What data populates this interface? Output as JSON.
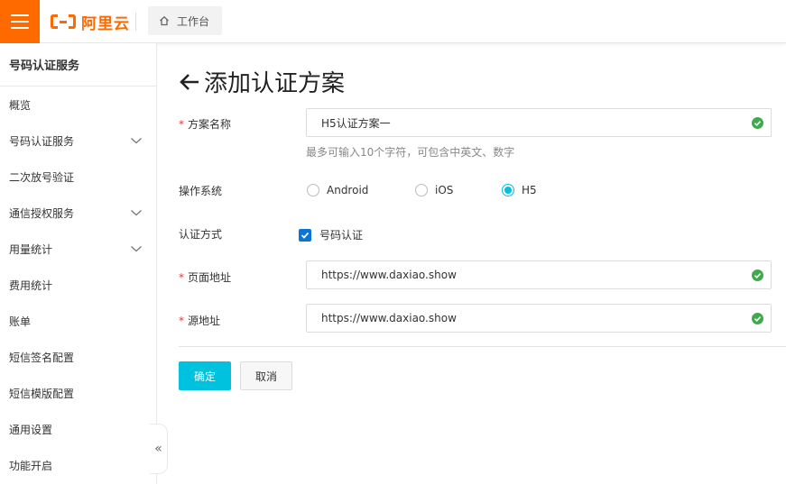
{
  "topbar": {
    "logo_text": "阿里云",
    "workbench_label": "工作台"
  },
  "sidebar": {
    "title": "号码认证服务",
    "items": [
      {
        "label": "概览",
        "expandable": false
      },
      {
        "label": "号码认证服务",
        "expandable": true
      },
      {
        "label": "二次放号验证",
        "expandable": false
      },
      {
        "label": "通信授权服务",
        "expandable": true
      },
      {
        "label": "用量统计",
        "expandable": true
      },
      {
        "label": "费用统计",
        "expandable": false
      },
      {
        "label": "账单",
        "expandable": false
      },
      {
        "label": "短信签名配置",
        "expandable": false
      },
      {
        "label": "短信模版配置",
        "expandable": false
      },
      {
        "label": "通用设置",
        "expandable": false
      },
      {
        "label": "功能开启",
        "expandable": false
      }
    ]
  },
  "page": {
    "title": "添加认证方案"
  },
  "form": {
    "required_mark": "*",
    "scheme_name": {
      "label": "方案名称",
      "value": "H5认证方案一",
      "hint": "最多可输入10个字符，可包含中英文、数字"
    },
    "os": {
      "label": "操作系统",
      "options": [
        "Android",
        "iOS",
        "H5"
      ],
      "selected": "H5"
    },
    "auth_method": {
      "label": "认证方式",
      "checkbox_label": "号码认证",
      "checked": true
    },
    "page_url": {
      "label": "页面地址",
      "value": "https://www.daxiao.show"
    },
    "origin_url": {
      "label": "源地址",
      "value": "https://www.daxiao.show"
    }
  },
  "buttons": {
    "confirm": "确定",
    "cancel": "取消"
  },
  "colors": {
    "brand": "#ff6a00",
    "primary": "#00c1de",
    "checkbox": "#0a74d8",
    "success": "#3dab4d",
    "required": "#e4393c"
  }
}
